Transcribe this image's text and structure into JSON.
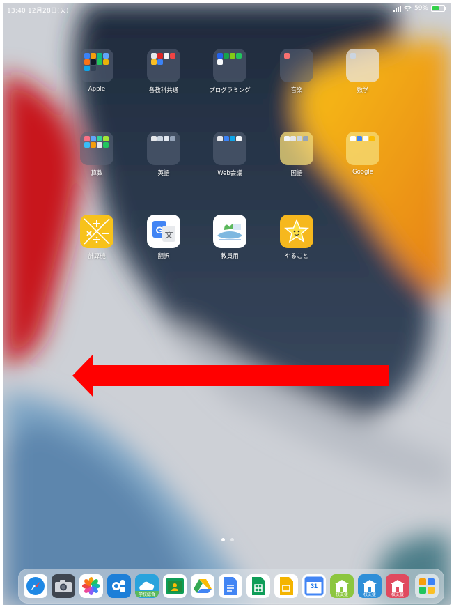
{
  "status_bar": {
    "time_date": "13:40  12月28日(火)",
    "battery": "59%",
    "battery_level": 0.59
  },
  "home_grid": [
    {
      "label": "Apple",
      "kind": "folder"
    },
    {
      "label": "各教科共通",
      "kind": "folder"
    },
    {
      "label": "プログラミング",
      "kind": "folder"
    },
    {
      "label": "音楽",
      "kind": "folder"
    },
    {
      "label": "数学",
      "kind": "folder"
    },
    {
      "label": "算数",
      "kind": "folder"
    },
    {
      "label": "英語",
      "kind": "folder"
    },
    {
      "label": "Web会議",
      "kind": "folder"
    },
    {
      "label": "国語",
      "kind": "folder"
    },
    {
      "label": "Google",
      "kind": "folder"
    },
    {
      "label": "計算機",
      "kind": "app",
      "icon": "calculator-icon"
    },
    {
      "label": "翻訳",
      "kind": "app",
      "icon": "google-translate-icon"
    },
    {
      "label": "教員用",
      "kind": "app",
      "icon": "teacher-app-icon"
    },
    {
      "label": "やること",
      "kind": "app",
      "icon": "star-face-icon"
    }
  ],
  "pages": {
    "count": 2,
    "current": 1
  },
  "dock": [
    {
      "name": "safari-icon"
    },
    {
      "name": "camera-icon"
    },
    {
      "name": "photos-icon"
    },
    {
      "name": "meeting-app-icon"
    },
    {
      "name": "school-cloud-icon",
      "text": "学校総合"
    },
    {
      "name": "classroom-icon"
    },
    {
      "name": "google-drive-icon"
    },
    {
      "name": "google-docs-icon"
    },
    {
      "name": "google-sheets-icon"
    },
    {
      "name": "google-slides-icon"
    },
    {
      "name": "google-calendar-icon",
      "text": "31"
    },
    {
      "name": "school-support-green-icon",
      "text": "校支援"
    },
    {
      "name": "school-support-blue-icon",
      "text": "校支援"
    },
    {
      "name": "school-support-red-icon",
      "text": "校支援"
    },
    {
      "name": "app-library-icon"
    }
  ],
  "colors": {
    "arrow": "#ff0000",
    "accent_yellow": "#f5b400"
  }
}
